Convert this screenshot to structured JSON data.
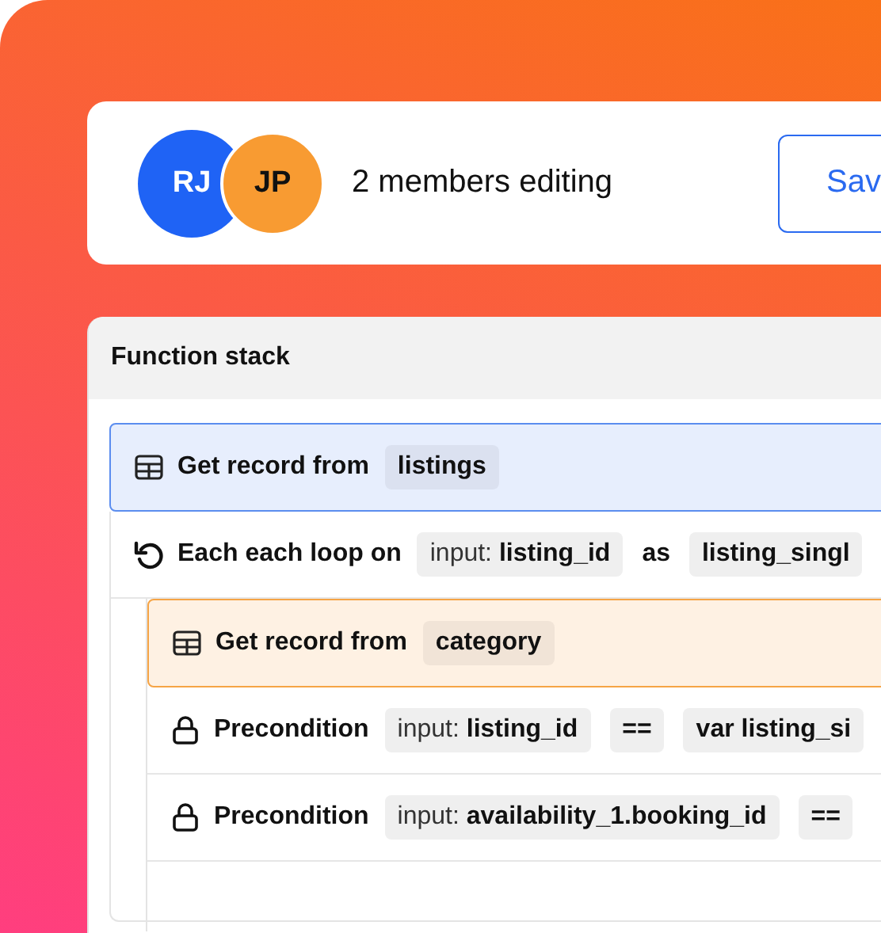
{
  "header": {
    "members": [
      {
        "initials": "RJ",
        "color": "#1f63f5"
      },
      {
        "initials": "JP",
        "color": "#f89b32"
      }
    ],
    "status": "2 members editing",
    "save_button": "Sav"
  },
  "panel": {
    "title": "Function stack",
    "steps": [
      {
        "kind": "record",
        "color": "#5b8def",
        "label": "Get record from",
        "tokens": [
          {
            "kind": "chip",
            "value": "listings"
          }
        ]
      },
      {
        "kind": "loop",
        "label": "Each each loop on",
        "tokens": [
          {
            "kind": "chip",
            "prefix": "input:",
            "value": "listing_id"
          },
          {
            "kind": "word",
            "value": "as"
          },
          {
            "kind": "chip",
            "value": "listing_singl"
          }
        ],
        "children": [
          {
            "kind": "record",
            "color": "#f6a445",
            "label": "Get record from",
            "tokens": [
              {
                "kind": "chip",
                "value": "category"
              }
            ]
          },
          {
            "kind": "precondition",
            "label": "Precondition",
            "tokens": [
              {
                "kind": "chip",
                "prefix": "input:",
                "value": "listing_id"
              },
              {
                "kind": "chip",
                "value": "=="
              },
              {
                "kind": "chip",
                "value": "var listing_si"
              }
            ]
          },
          {
            "kind": "precondition",
            "label": "Precondition",
            "tokens": [
              {
                "kind": "chip",
                "prefix": "input:",
                "value": "availability_1.booking_id"
              },
              {
                "kind": "chip",
                "value": "=="
              }
            ]
          }
        ]
      }
    ]
  }
}
